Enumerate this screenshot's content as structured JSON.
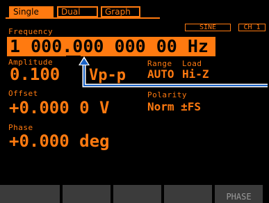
{
  "tabs": [
    {
      "label": "Single",
      "active": true
    },
    {
      "label": "Dual",
      "active": false
    },
    {
      "label": "Graph",
      "active": false
    }
  ],
  "waveform": "SINE",
  "channel": "CH 1",
  "frequency": {
    "label": "Frequency",
    "value": "1 000.000 000 00 Hz"
  },
  "amplitude": {
    "label": "Amplitude",
    "value": "0.100",
    "unit": "Vp-p"
  },
  "offset": {
    "label": "Offset",
    "value": "+0.000 0 V"
  },
  "phase": {
    "label": "Phase",
    "value": "+0.000 deg"
  },
  "range": {
    "label": "Range",
    "value": "AUTO"
  },
  "load": {
    "label": "Load",
    "value": "Hi-Z"
  },
  "polarity": {
    "label": "Polarity",
    "value": "Norm ±FS"
  },
  "softkeys": [
    "",
    "",
    "",
    "",
    "PHASE"
  ],
  "colors": {
    "accent": "#ff7a10",
    "annotation": "#1a63c8",
    "softkey_bg": "#3b3b3b",
    "background": "#000000"
  }
}
